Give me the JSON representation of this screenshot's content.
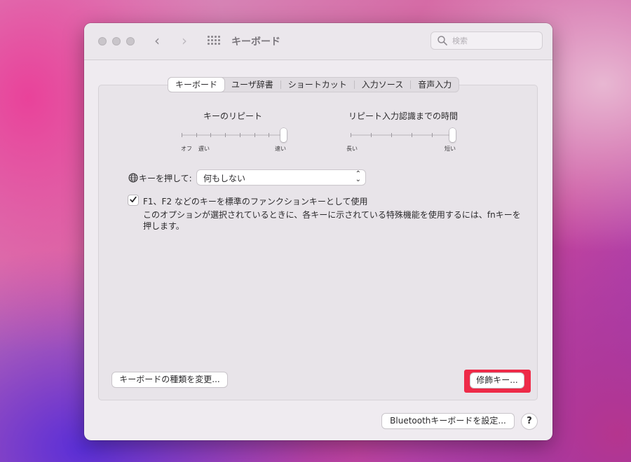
{
  "window": {
    "title": "キーボード",
    "search_placeholder": "検索"
  },
  "tabs": [
    {
      "label": "キーボード",
      "selected": true
    },
    {
      "label": "ユーザ辞書",
      "selected": false
    },
    {
      "label": "ショートカット",
      "selected": false
    },
    {
      "label": "入力ソース",
      "selected": false
    },
    {
      "label": "音声入力",
      "selected": false
    }
  ],
  "key_repeat": {
    "label": "キーのリピート",
    "min_label": "オフ",
    "slow_label": "遅い",
    "max_label": "速い",
    "value_fraction": 1.0
  },
  "repeat_delay": {
    "label": "リピート入力認識までの時間",
    "min_label": "長い",
    "max_label": "短い",
    "value_fraction": 1.0
  },
  "globe_key": {
    "label": "キーを押して:",
    "selected_value": "何もしない"
  },
  "fn_keys": {
    "checked": true,
    "label": "F1、F2 などのキーを標準のファンクションキーとして使用",
    "description": "このオプションが選択されているときに、各キーに示されている特殊機能を使用するには、fnキーを押します。"
  },
  "buttons": {
    "change_keyboard_type": "キーボードの種類を変更...",
    "modifier_keys": "修飾キー...",
    "bluetooth_setup": "Bluetoothキーボードを設定...",
    "help": "?"
  },
  "colors": {
    "highlight": "#ee2a48"
  }
}
